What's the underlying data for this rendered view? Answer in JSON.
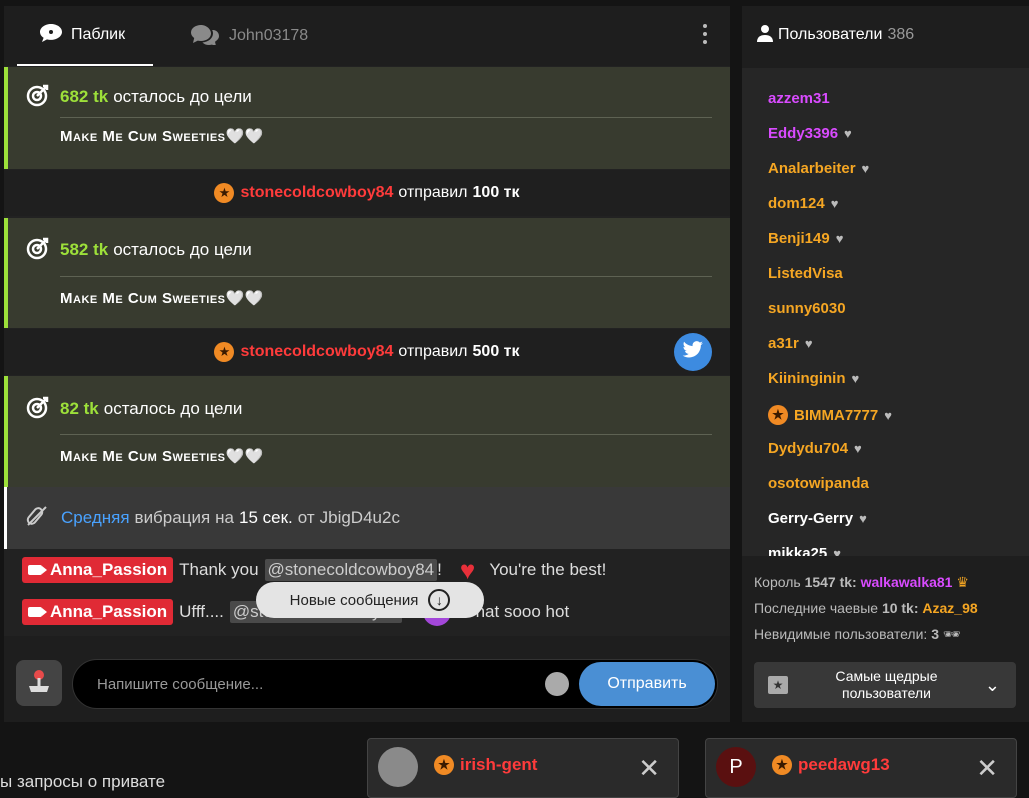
{
  "tabs": {
    "public": "Паблик",
    "private": "John03178"
  },
  "goals": [
    {
      "amount": "682 tk",
      "text": "осталось до цели",
      "subject": "Make Me Cum Sweeties🤍🤍"
    },
    {
      "amount": "582 tk",
      "text": "осталось до цели",
      "subject": "Make Me Cum Sweeties🤍🤍"
    },
    {
      "amount": "82 tk",
      "text": "осталось до цели",
      "subject": "Make Me Cum Sweeties🤍🤍"
    }
  ],
  "tips": [
    {
      "user": "stonecoldcowboy84",
      "verb": "отправил",
      "amount": "100 тк"
    },
    {
      "user": "stonecoldcowboy84",
      "verb": "отправил",
      "amount": "500 тк"
    }
  ],
  "vibration": {
    "level": "Средняя",
    "text1": "вибрация",
    "text2": "на",
    "duration": "15 сек.",
    "text3": "от",
    "user": "JbigD4u2c"
  },
  "messages": [
    {
      "user": "Anna_Passion",
      "pre": "Thank you",
      "mention": "@stonecoldcowboy84",
      "post": "!",
      "emoji": "❤️",
      "tail": "You're the best!"
    },
    {
      "user": "Anna_Passion",
      "pre": "Ufff....",
      "mention": "@stonecoldcowboy84",
      "post": "!",
      "emoji": "😈",
      "tail": "That sooo hot"
    }
  ],
  "new_messages": "Новые сообщения",
  "input": {
    "placeholder": "Напишите сообщение...",
    "send": "Отправить"
  },
  "users": {
    "title": "Пользователи",
    "count": "386",
    "list": [
      {
        "name": "azzem31",
        "color": "#d94bff",
        "heart": false
      },
      {
        "name": "Eddy3396",
        "color": "#d94bff",
        "heart": true
      },
      {
        "name": "Analarbeiter",
        "color": "#f5a623",
        "heart": true
      },
      {
        "name": "dom124",
        "color": "#f5a623",
        "heart": true
      },
      {
        "name": "Benji149",
        "color": "#f5a623",
        "heart": true
      },
      {
        "name": "ListedVisa",
        "color": "#f5a623",
        "heart": false
      },
      {
        "name": "sunny6030",
        "color": "#f5a623",
        "heart": false
      },
      {
        "name": "a31r",
        "color": "#f5a623",
        "heart": true
      },
      {
        "name": "Kiininginin",
        "color": "#f5a623",
        "heart": true
      },
      {
        "name": "BIMMA7777",
        "color": "#f5a623",
        "heart": true,
        "star": true
      },
      {
        "name": "Dydydu704",
        "color": "#f5a623",
        "heart": true
      },
      {
        "name": "osotowipanda",
        "color": "#f5a623",
        "heart": false
      },
      {
        "name": "Gerry-Gerry",
        "color": "#ffffff",
        "heart": true
      },
      {
        "name": "mikka25",
        "color": "#ffffff",
        "heart": true
      }
    ],
    "king_label": "Король",
    "king_amount": "1547 tk:",
    "king_user": "walkawalka81",
    "last_label": "Последние чаевые",
    "last_amount": "10 tk:",
    "last_user": "Azaz_98",
    "invisible_label": "Невидимые пользователи:",
    "invisible_count": "3",
    "generous": "Самые щедрые пользователи"
  },
  "popups": [
    {
      "user": "irish-gent"
    },
    {
      "user": "peedawg13",
      "initial": "P"
    }
  ],
  "private_text": "ы запросы о привате"
}
